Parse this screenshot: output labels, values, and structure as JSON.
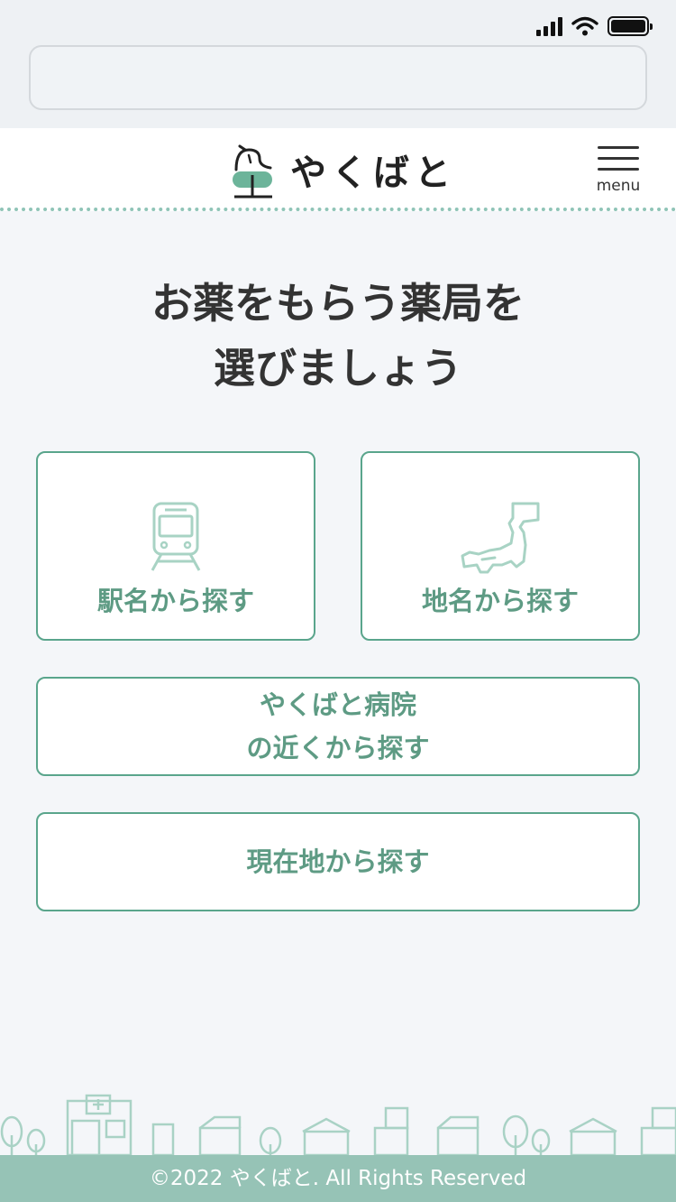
{
  "header": {
    "logo_text": "やくばと",
    "menu_label": "menu"
  },
  "main": {
    "title_line1": "お薬をもらう薬局を",
    "title_line2": "選びましょう",
    "buttons": {
      "station": "駅名から探す",
      "area": "地名から探す",
      "hospital_line1": "やくばと病院",
      "hospital_line2": "の近くから探す",
      "current": "現在地から探す"
    }
  },
  "footer": {
    "copyright": "©2022 やくばと. All Rights Reserved"
  },
  "colors": {
    "accent": "#5aa58c",
    "label": "#5e9b84",
    "footer": "#96c3b6",
    "background": "#f4f6f9"
  }
}
